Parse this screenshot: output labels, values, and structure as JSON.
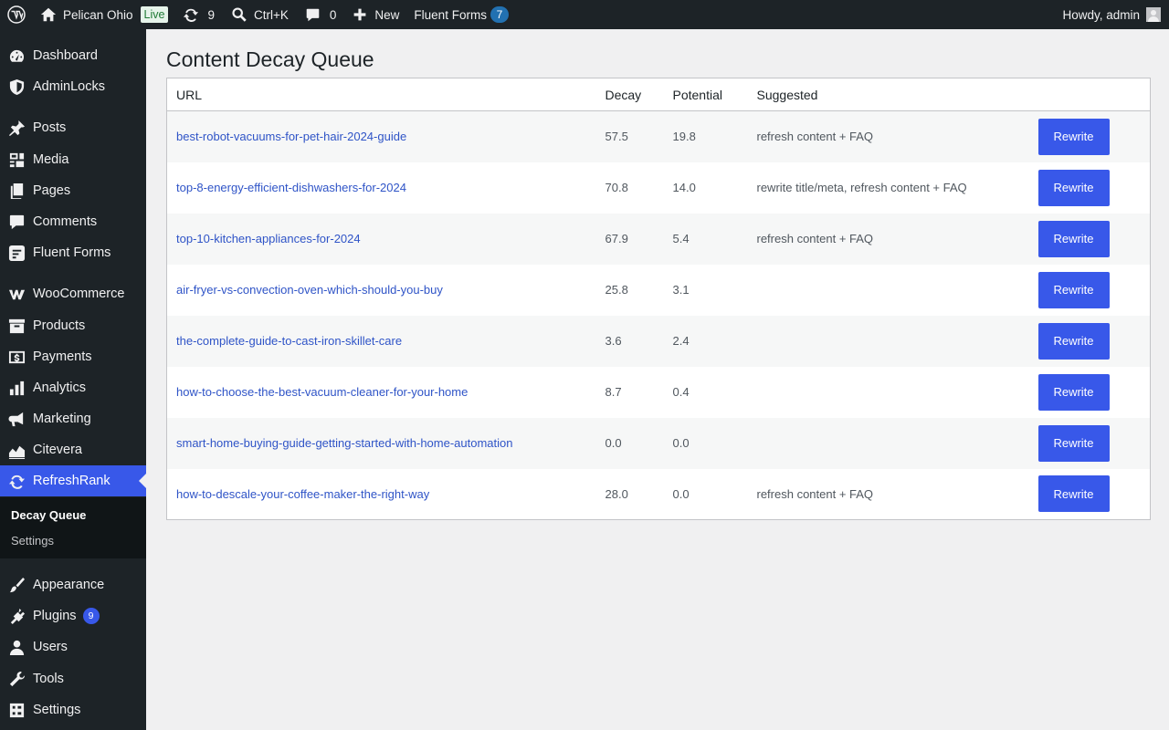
{
  "admin_bar": {
    "site_name": "Pelican Ohio",
    "live_label": "Live",
    "updates_count": "9",
    "search_shortcut": "Ctrl+K",
    "comments_count": "0",
    "new_label": "New",
    "fluent_forms_label": "Fluent Forms",
    "fluent_forms_count": "7",
    "greeting": "Howdy, admin"
  },
  "sidebar": {
    "items": [
      {
        "label": "Dashboard",
        "icon": "dashboard-icon"
      },
      {
        "label": "AdminLocks",
        "icon": "shield-icon"
      },
      {
        "label": "Posts",
        "icon": "pin-icon"
      },
      {
        "label": "Media",
        "icon": "media-icon"
      },
      {
        "label": "Pages",
        "icon": "pages-icon"
      },
      {
        "label": "Comments",
        "icon": "comment-icon"
      },
      {
        "label": "Fluent Forms",
        "icon": "forms-icon"
      },
      {
        "label": "WooCommerce",
        "icon": "woo-icon"
      },
      {
        "label": "Products",
        "icon": "archive-icon"
      },
      {
        "label": "Payments",
        "icon": "dollar-icon"
      },
      {
        "label": "Analytics",
        "icon": "bar-chart-icon"
      },
      {
        "label": "Marketing",
        "icon": "megaphone-icon"
      },
      {
        "label": "Citevera",
        "icon": "area-chart-icon"
      },
      {
        "label": "RefreshRank",
        "icon": "refresh-icon"
      },
      {
        "label": "Appearance",
        "icon": "brush-icon"
      },
      {
        "label": "Plugins",
        "icon": "plug-icon",
        "badge": "9"
      },
      {
        "label": "Users",
        "icon": "user-icon"
      },
      {
        "label": "Tools",
        "icon": "wrench-icon"
      },
      {
        "label": "Settings",
        "icon": "settings-icon"
      }
    ],
    "submenu": {
      "current": "Decay Queue",
      "other": "Settings"
    }
  },
  "page": {
    "title": "Content Decay Queue",
    "columns": [
      "URL",
      "Decay",
      "Potential",
      "Suggested"
    ],
    "action_label": "Rewrite",
    "rows": [
      {
        "url": "best-robot-vacuums-for-pet-hair-2024-guide",
        "decay": "57.5",
        "potential": "19.8",
        "suggested": "refresh content + FAQ"
      },
      {
        "url": "top-8-energy-efficient-dishwashers-for-2024",
        "decay": "70.8",
        "potential": "14.0",
        "suggested": "rewrite title/meta, refresh content + FAQ"
      },
      {
        "url": "top-10-kitchen-appliances-for-2024",
        "decay": "67.9",
        "potential": "5.4",
        "suggested": "refresh content + FAQ"
      },
      {
        "url": "air-fryer-vs-convection-oven-which-should-you-buy",
        "decay": "25.8",
        "potential": "3.1",
        "suggested": ""
      },
      {
        "url": "the-complete-guide-to-cast-iron-skillet-care",
        "decay": "3.6",
        "potential": "2.4",
        "suggested": ""
      },
      {
        "url": "how-to-choose-the-best-vacuum-cleaner-for-your-home",
        "decay": "8.7",
        "potential": "0.4",
        "suggested": ""
      },
      {
        "url": "smart-home-buying-guide-getting-started-with-home-automation",
        "decay": "0.0",
        "potential": "0.0",
        "suggested": ""
      },
      {
        "url": "how-to-descale-your-coffee-maker-the-right-way",
        "decay": "28.0",
        "potential": "0.0",
        "suggested": "refresh content + FAQ"
      }
    ]
  },
  "colors": {
    "admin_dark": "#1d2327",
    "accent": "#3858e9",
    "link": "#2f54c7",
    "content_bg": "#f0f0f1"
  }
}
